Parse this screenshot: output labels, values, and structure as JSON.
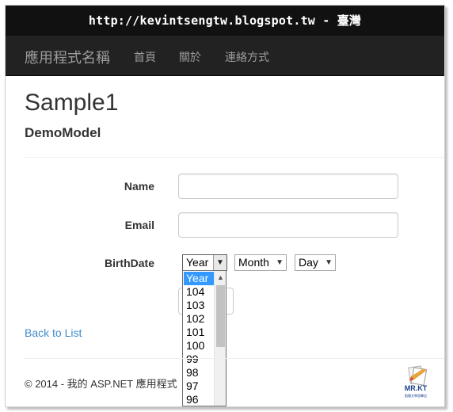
{
  "banner": {
    "text": "http://kevintsengtw.blogspot.tw - 臺灣"
  },
  "navbar": {
    "brand": "應用程式名稱",
    "items": [
      "首頁",
      "關於",
      "連絡方式"
    ]
  },
  "page": {
    "title": "Sample1",
    "model": "DemoModel"
  },
  "form": {
    "name_label": "Name",
    "email_label": "Email",
    "birthdate_label": "BirthDate",
    "name_value": "",
    "email_value": "",
    "year_select": "Year",
    "month_select": "Month",
    "day_select": "Day",
    "year_options": [
      "Year",
      "104",
      "103",
      "102",
      "101",
      "100",
      "99",
      "98",
      "97",
      "96"
    ]
  },
  "back_link": "Back to List",
  "footer": "© 2014 - 我的 ASP.NET 應用程式",
  "logo": {
    "text": "MR.KT",
    "subtext": "凱爾文學習筆記"
  },
  "colors": {
    "link": "#428bca",
    "navbar": "#222222",
    "selected_option": "#3399ff"
  }
}
